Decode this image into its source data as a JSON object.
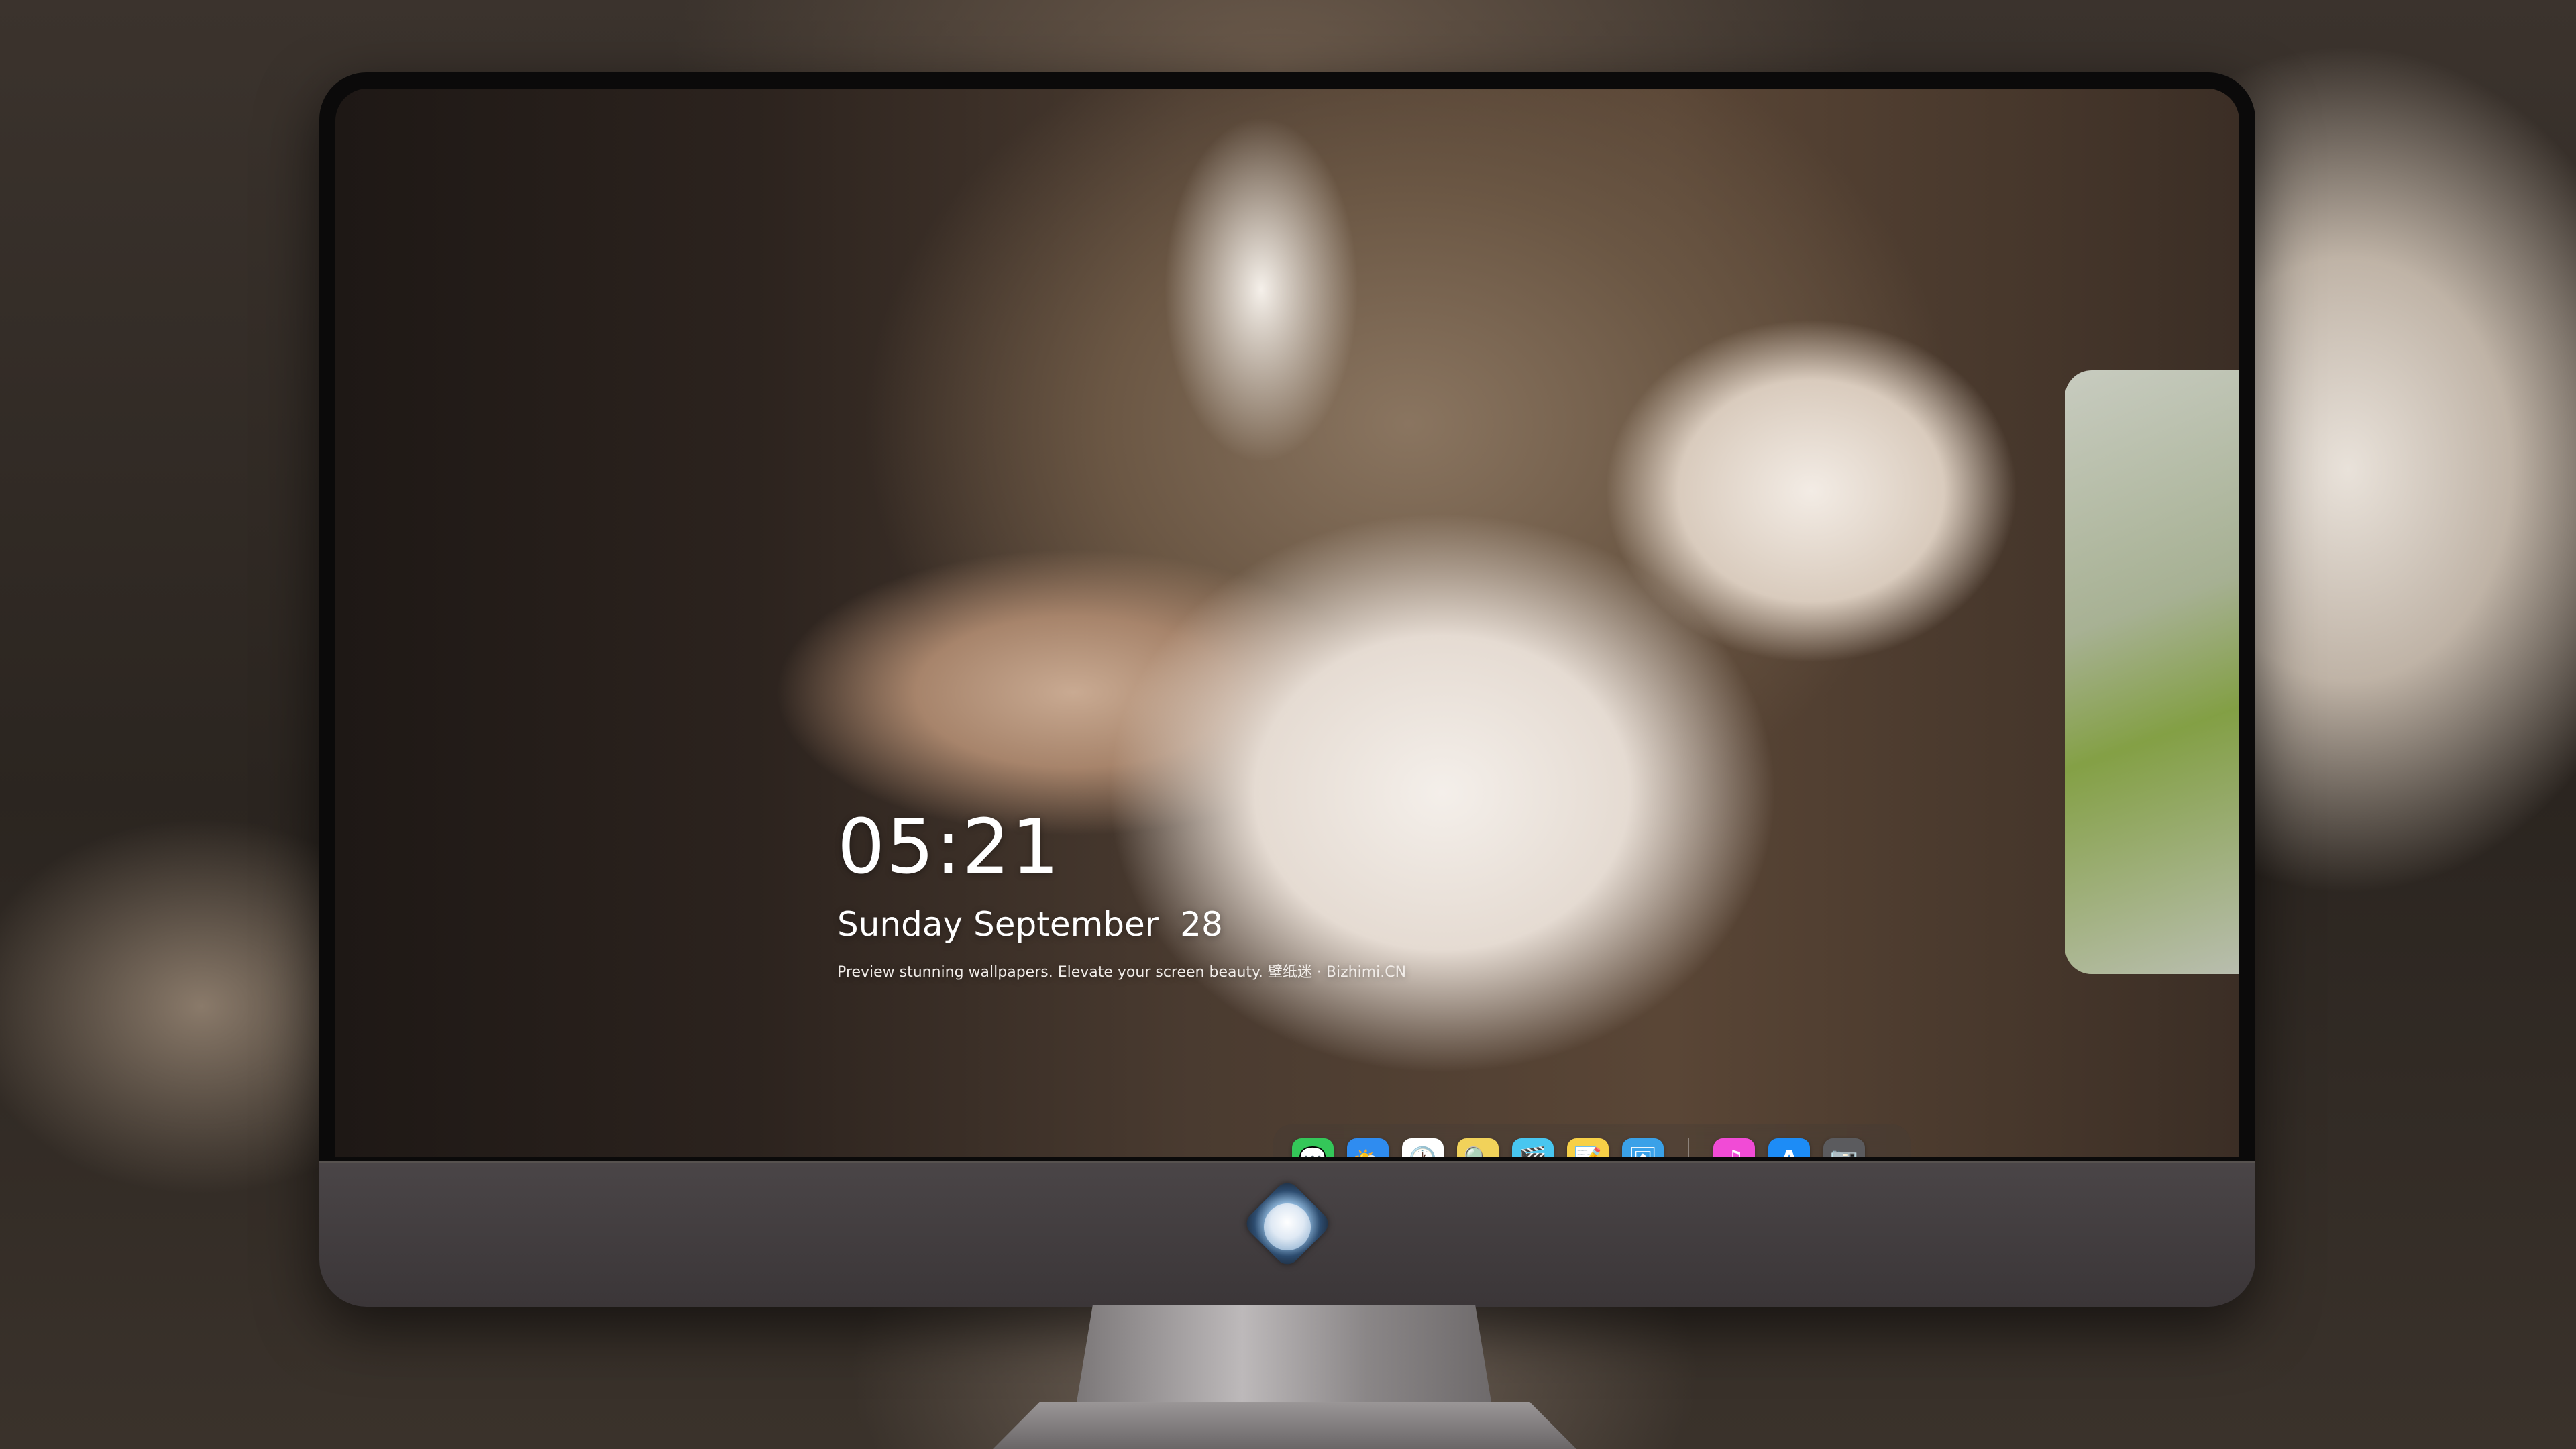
{
  "lock_screen": {
    "time": "05:21",
    "date": "Sunday September  28",
    "tagline": "Preview stunning wallpapers. Elevate your screen beauty. 壁纸迷 · Bizhimi.CN"
  },
  "dock": {
    "apps": [
      {
        "name": "messages-icon",
        "glyph": "💬",
        "color": "#34c759"
      },
      {
        "name": "weather-icon",
        "glyph": "⛅",
        "color": "#2f8cf0"
      },
      {
        "name": "clock-icon",
        "glyph": "🕐",
        "color": "#ffffff"
      },
      {
        "name": "preview-icon",
        "glyph": "🔍",
        "color": "#f1d25a"
      },
      {
        "name": "clips-icon",
        "glyph": "🎬",
        "color": "#48c6f0"
      },
      {
        "name": "notes-icon",
        "glyph": "📝",
        "color": "#f7d047"
      },
      {
        "name": "photo-booth-icon",
        "glyph": "🖼",
        "color": "#3aa1e8"
      },
      {
        "name": "music-icon",
        "glyph": "♫",
        "color": "#f14bd6"
      },
      {
        "name": "app-store-icon",
        "glyph": "A",
        "color": "#1d8cf6"
      },
      {
        "name": "camera-icon",
        "glyph": "📷",
        "color": "#5b5b5e"
      }
    ]
  }
}
